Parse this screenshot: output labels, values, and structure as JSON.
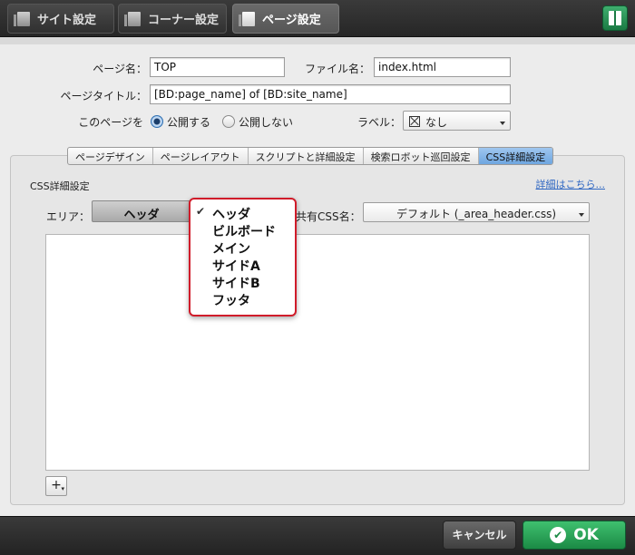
{
  "top_tabs": [
    {
      "label": "サイト設定",
      "icon": "document-icon"
    },
    {
      "label": "コーナー設定",
      "icon": "document-icon"
    },
    {
      "label": "ページ設定",
      "icon": "document-icon",
      "active": true
    }
  ],
  "help_icon": "book-icon",
  "form": {
    "page_name_label": "ページ名：",
    "page_name_value": "TOP",
    "file_name_label": "ファイル名：",
    "file_name_value": "index.html",
    "page_title_label": "ページタイトル：",
    "page_title_value": "[BD:page_name] of [BD:site_name]",
    "publish_label": "このページを",
    "publish_option": "公開する",
    "unpublish_option": "公開しない",
    "publish_selected": "公開する",
    "label_label": "ラベル：",
    "label_value": "なし"
  },
  "sub_tabs": [
    "ページデザイン",
    "ページレイアウト",
    "スクリプトと詳細設定",
    "検索ロボット巡回設定",
    "CSS詳細設定"
  ],
  "sub_tab_selected": "CSS詳細設定",
  "css_section": {
    "title": "CSS詳細設定",
    "detail_link": "詳細はこちら...",
    "area_label": "エリア：",
    "area_selected": "ヘッダ",
    "shared_css_label": "共有CSS名：",
    "shared_css_value": "デフォルト (_area_header.css)",
    "plus_label": "+"
  },
  "area_dropdown": {
    "items": [
      "ヘッダ",
      "ビルボード",
      "メイン",
      "サイドA",
      "サイドB",
      "フッタ"
    ],
    "checked": "ヘッダ"
  },
  "footer": {
    "cancel_label": "キャンセル",
    "ok_label": "OK"
  },
  "colors": {
    "accent_green": "#1b8a45",
    "dropdown_highlight": "#d01c2a",
    "link_blue": "#2f67c2"
  }
}
